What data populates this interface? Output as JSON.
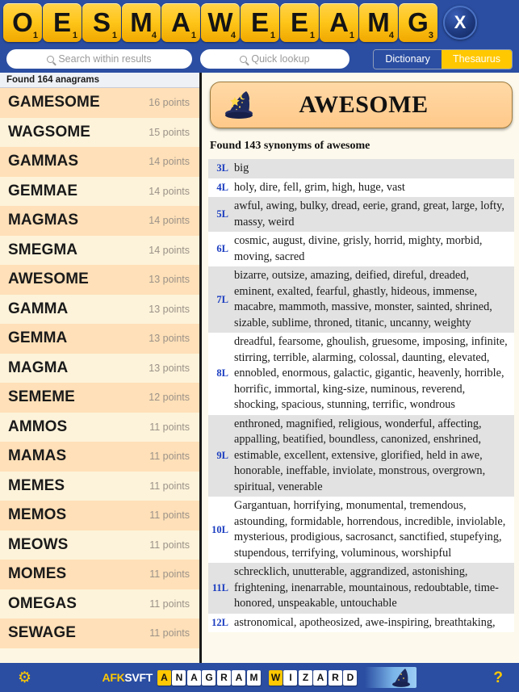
{
  "rack": {
    "tiles": [
      {
        "letter": "O",
        "value": "1"
      },
      {
        "letter": "E",
        "value": "1"
      },
      {
        "letter": "S",
        "value": "1"
      },
      {
        "letter": "M",
        "value": "4"
      },
      {
        "letter": "A",
        "value": "1"
      },
      {
        "letter": "W",
        "value": "4"
      },
      {
        "letter": "E",
        "value": "1"
      },
      {
        "letter": "E",
        "value": "1"
      },
      {
        "letter": "A",
        "value": "1"
      },
      {
        "letter": "M",
        "value": "4"
      },
      {
        "letter": "G",
        "value": "3"
      }
    ],
    "close_label": "X",
    "close_icon": "close-icon"
  },
  "search": {
    "within_results_placeholder": "Search within results",
    "within_results_value": "",
    "quick_lookup_placeholder": "Quick lookup",
    "quick_lookup_value": "",
    "search_icon": "search-icon",
    "mode_dictionary": "Dictionary",
    "mode_thesaurus": "Thesaurus",
    "mode_selected": "Thesaurus"
  },
  "results": {
    "header": "Found 164 anagrams",
    "points_suffix": "points",
    "items": [
      {
        "word": "GAMESOME",
        "points": "16 points"
      },
      {
        "word": "WAGSOME",
        "points": "15 points"
      },
      {
        "word": "GAMMAS",
        "points": "14 points"
      },
      {
        "word": "GEMMAE",
        "points": "14 points"
      },
      {
        "word": "MAGMAS",
        "points": "14 points"
      },
      {
        "word": "SMEGMA",
        "points": "14 points"
      },
      {
        "word": "AWESOME",
        "points": "13 points"
      },
      {
        "word": "GAMMA",
        "points": "13 points"
      },
      {
        "word": "GEMMA",
        "points": "13 points"
      },
      {
        "word": "MAGMA",
        "points": "13 points"
      },
      {
        "word": "SEMEME",
        "points": "12 points"
      },
      {
        "word": "AMMOS",
        "points": "11 points"
      },
      {
        "word": "MAMAS",
        "points": "11 points"
      },
      {
        "word": "MEMES",
        "points": "11 points"
      },
      {
        "word": "MEMOS",
        "points": "11 points"
      },
      {
        "word": "MEOWS",
        "points": "11 points"
      },
      {
        "word": "MOMES",
        "points": "11 points"
      },
      {
        "word": "OMEGAS",
        "points": "11 points"
      },
      {
        "word": "SEWAGE",
        "points": "11 points"
      }
    ]
  },
  "detail": {
    "hat_icon": "wizard-hat-icon",
    "word": "AWESOME",
    "summary": "Found 143 synonyms of awesome",
    "groups": [
      {
        "len": "3L",
        "words": "big"
      },
      {
        "len": "4L",
        "words": "holy, dire, fell, grim, high, huge, vast"
      },
      {
        "len": "5L",
        "words": "awful, awing, bulky, dread, eerie, grand, great, large, lofty, massy, weird"
      },
      {
        "len": "6L",
        "words": "cosmic, august, divine, grisly, horrid, mighty, morbid, moving, sacred"
      },
      {
        "len": "7L",
        "words": "bizarre, outsize, amazing, deified, direful, dreaded, eminent, exalted, fearful, ghastly, hideous, immense, macabre, mammoth, massive, monster, sainted, shrined, sizable, sublime, throned, titanic, uncanny, weighty"
      },
      {
        "len": "8L",
        "words": "dreadful, fearsome, ghoulish, gruesome, imposing, infinite, stirring, terrible, alarming, colossal, daunting, elevated, ennobled, enormous, galactic, gigantic, heavenly, horrible, horrific, immortal, king-size, numinous, reverend, shocking, spacious, stunning, terrific, wondrous"
      },
      {
        "len": "9L",
        "words": "enthroned, magnified, religious, wonderful, affecting, appalling, beatified, boundless, canonized, enshrined, estimable, excellent, extensive, glorified, held in awe, honorable, ineffable, inviolate, monstrous, overgrown, spiritual, venerable"
      },
      {
        "len": "10L",
        "words": "Gargantuan, horrifying, monumental, tremendous, astounding, formidable, horrendous, incredible, inviolable, mysterious, prodigious, sacrosanct, sanctified, stupefying, stupendous, terrifying, voluminous, worshipful"
      },
      {
        "len": "11L",
        "words": "schrecklich, unutterable, aggrandized, astonishing, frightening, inenarrable, mountainous, redoubtable, time-honored, unspeakable, untouchable"
      },
      {
        "len": "12L",
        "words": "astronomical, apotheosized, awe-inspiring, breathtaking,"
      }
    ]
  },
  "footer": {
    "gear_icon": "gear-icon",
    "brand_yellow": "AFK",
    "brand_white": "SVFT",
    "title_tiles": [
      "A",
      "N",
      "A",
      "G",
      "R",
      "A",
      "M",
      "",
      "W",
      "I",
      "Z",
      "A",
      "R",
      "D"
    ],
    "highlight_indices": [
      0,
      8
    ],
    "hat_icon": "wizard-hat-icon",
    "help_icon": "help-icon",
    "help_label": "?"
  },
  "colors": {
    "chrome_blue": "#2b4ea2",
    "tile_yellow": "#ffc61a",
    "accent_yellow": "#ffc800",
    "paper": "#fdf6e3",
    "row_peach": "#ffe0b8",
    "row_cream": "#fdf3da",
    "syn_shade": "#e2e2e2",
    "len_blue": "#1a3cc0"
  }
}
